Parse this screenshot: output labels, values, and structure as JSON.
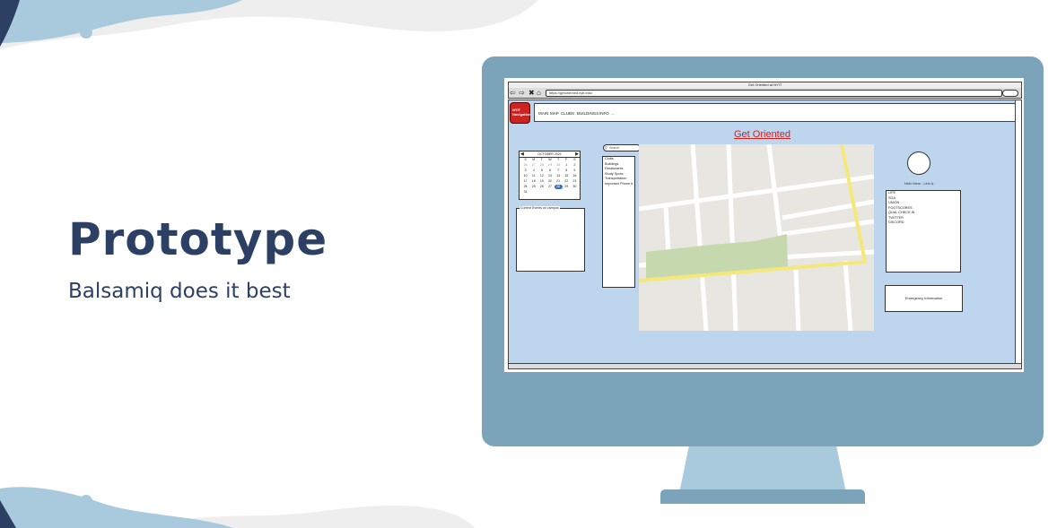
{
  "slide": {
    "title": "Prototype",
    "subtitle": "Balsamiq does it best"
  },
  "colors": {
    "title_text": "#2c4064",
    "monitor_frame": "#7ba3b9",
    "monitor_stand": "#a9cadc",
    "page_background": "#bdd6ee",
    "heading_red": "#cc2222",
    "map_road_yellow": "#f5e87a",
    "map_park_green": "#c6d8ad"
  },
  "browser": {
    "window_title": "Get Oriented at NYIT",
    "url": "https://getoriented.nyit.edu/",
    "nav_icons": [
      "back-arrow-icon",
      "forward-arrow-icon",
      "close-icon",
      "home-icon"
    ]
  },
  "app": {
    "logo_text": "NYIT Navigation",
    "menu": [
      "MAIN",
      "MAP",
      "CLUBS",
      "BUILDINGS",
      "INFO",
      "..."
    ],
    "heading": "Get Oriented"
  },
  "calendar": {
    "month_label": "OCTOBER 2021",
    "weekdays": [
      "S",
      "M",
      "T",
      "W",
      "T",
      "F",
      "S"
    ],
    "days": [
      "26",
      "27",
      "28",
      "29",
      "30",
      "1",
      "2",
      "3",
      "4",
      "5",
      "6",
      "7",
      "8",
      "9",
      "10",
      "11",
      "12",
      "13",
      "14",
      "15",
      "16",
      "17",
      "18",
      "19",
      "20",
      "21",
      "22",
      "23",
      "24",
      "25",
      "26",
      "27",
      "28",
      "29",
      "30",
      "31"
    ],
    "selected_day_index": 32
  },
  "events": {
    "label": "Current Events on campus"
  },
  "sidebar": {
    "search_placeholder": "Search",
    "items": [
      "Clubs",
      "Buildings",
      "Restaurants",
      "Study Spots",
      "Transportation",
      "Important Phone #"
    ]
  },
  "profile": {
    "username": "Hello there - Linh A.",
    "social_links": [
      "LIFE",
      "SGA",
      "UNION",
      "FOOTSCORES",
      "QUAL CHECK IN",
      "TWITTER",
      "DISCORD"
    ]
  },
  "emergency": {
    "label": "Emergency Information"
  }
}
